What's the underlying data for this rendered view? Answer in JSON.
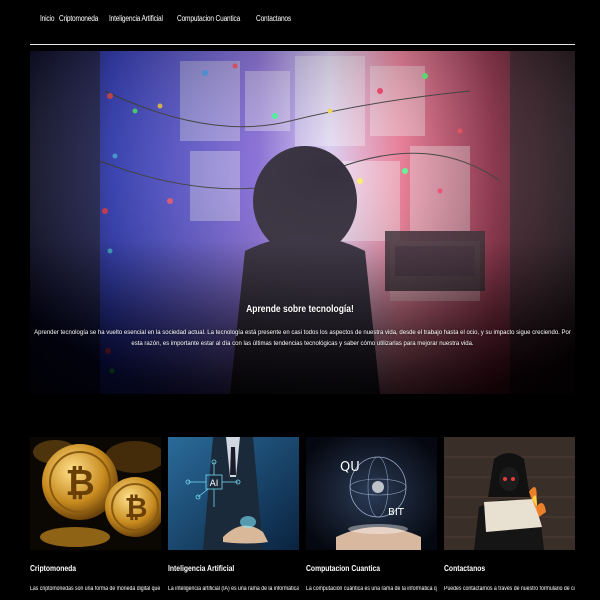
{
  "nav": {
    "items": [
      {
        "label": "Inicio"
      },
      {
        "label": "Criptomoneda"
      },
      {
        "label": "Inteligencia Artificial"
      },
      {
        "label": "Computacion Cuantica"
      },
      {
        "label": "Contactanos"
      }
    ]
  },
  "hero": {
    "title": "Aprende sobre tecnología!",
    "text": "Aprender tecnología se ha vuelto esencial en la sociedad actual. La tecnología está presente en casi todos los aspectos de nuestra vida, desde el trabajo hasta el ocio, y su impacto sigue creciendo. Por esta razón, es importante estar al día con las últimas tendencias tecnológicas y saber cómo utilizarlas para mejorar nuestra vida."
  },
  "cards": [
    {
      "title": "Criptomoneda",
      "text": "Las criptomonedas son una forma de moneda digital que utilizan la",
      "image_icon": "bitcoin-coins-image"
    },
    {
      "title": "Inteligencia Artificial",
      "text": "La inteligencia artificial (IA) es una rama de la informática que estudia",
      "image_icon": "ai-hand-image",
      "image_label": "AI"
    },
    {
      "title": "Computacion Cuantica",
      "text": "La computación cuántica es una rama de la informática que se enfoca",
      "image_icon": "qubit-image",
      "image_label_top": "QU",
      "image_label_bottom": "BIT"
    },
    {
      "title": "Contactanos",
      "text": "Puedes contactarnos a través de nuestro formulario de contacto en",
      "image_icon": "hacker-image"
    }
  ],
  "colors": {
    "background": "#000000",
    "text": "#ffffff",
    "divider": "#e6e6e6"
  }
}
